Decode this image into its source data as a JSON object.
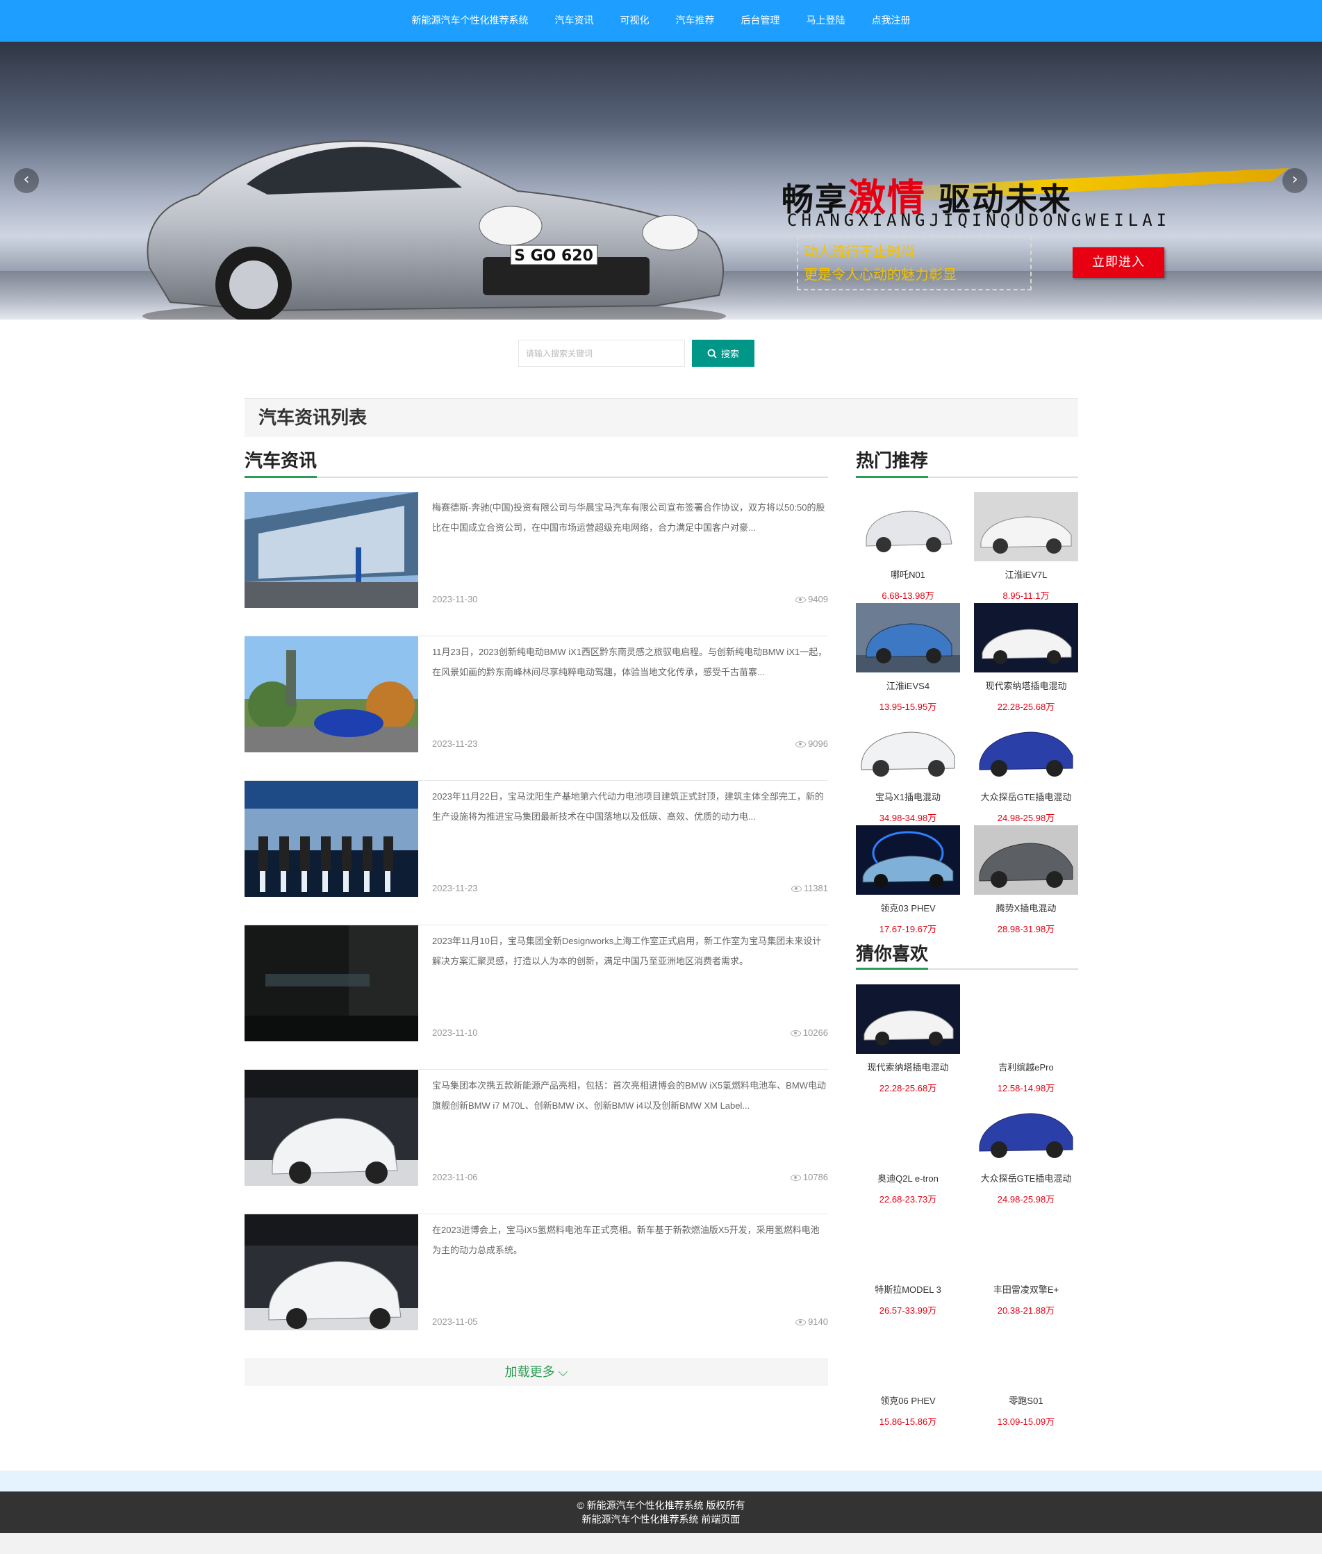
{
  "nav": {
    "items": [
      "新能源汽车个性化推荐系统",
      "汽车资讯",
      "可视化",
      "汽车推荐",
      "后台管理",
      "马上登陆",
      "点我注册"
    ]
  },
  "banner": {
    "slogan_a": "畅享",
    "slogan_hot": "激情",
    "slogan_b": " 驱动未来",
    "pinyin": "CHANGXIANGJIQINQUDONGWEILAI",
    "line1": "动人流行不止时尚",
    "line2": "更是令人心动的魅力彰显",
    "enter": "立即进入",
    "plate": "S GO 620",
    "prev": "‹",
    "next": "›",
    "active_slide": 1,
    "slide_count": 3
  },
  "search": {
    "placeholder": "请输入搜索关键词",
    "button": "搜索"
  },
  "list_header": "汽车资讯列表",
  "news_section": {
    "title": "汽车资讯",
    "items": [
      {
        "text": "梅赛德斯-奔驰(中国)投资有限公司与华晨宝马汽车有限公司宣布签署合作协议，双方将以50:50的股比在中国成立合资公司，在中国市场运营超级充电网络，合力满足中国客户对豪...",
        "date": "2023-11-30",
        "views": "9409"
      },
      {
        "text": "11月23日，2023创新纯电动BMW iX1西区黔东南灵感之旅驭电启程。与创新纯电动BMW iX1一起，在风景如画的黔东南峰林间尽享纯粹电动驾趣，体验当地文化传承，感受千古苗寨...",
        "date": "2023-11-23",
        "views": "9096"
      },
      {
        "text": "2023年11月22日，宝马沈阳生产基地第六代动力电池项目建筑正式封顶，建筑主体全部完工，新的生产设施将为推进宝马集团最新技术在中国落地以及低碳、高效、优质的动力电...",
        "date": "2023-11-23",
        "views": "11381"
      },
      {
        "text": "2023年11月10日，宝马集团全新Designworks上海工作室正式启用，新工作室为宝马集团未来设计解决方案汇聚灵感，打造以人为本的创新，满足中国乃至亚洲地区消费者需求。",
        "date": "2023-11-10",
        "views": "10266"
      },
      {
        "text": "宝马集团本次携五款新能源产品亮相，包括：首次亮相进博会的BMW iX5氢燃料电池车、BMW电动旗舰创新BMW i7 M70L、创新BMW iX、创新BMW i4以及创新BMW XM Label...",
        "date": "2023-11-06",
        "views": "10786"
      },
      {
        "text": "在2023进博会上，宝马iX5氢燃料电池车正式亮相。新车基于新款燃油版X5开发，采用氢燃料电池为主的动力总成系统。",
        "date": "2023-11-05",
        "views": "9140"
      }
    ],
    "load_more": "加载更多 ⌵"
  },
  "hot_section": {
    "title": "热门推荐",
    "items": [
      {
        "name": "哪吒N01",
        "price": "6.68-13.98万"
      },
      {
        "name": "江淮iEV7L",
        "price": "8.95-11.1万"
      },
      {
        "name": "江淮iEVS4",
        "price": "13.95-15.95万"
      },
      {
        "name": "现代索纳塔插电混动",
        "price": "22.28-25.68万"
      },
      {
        "name": "宝马X1插电混动",
        "price": "34.98-34.98万"
      },
      {
        "name": "大众探岳GTE插电混动",
        "price": "24.98-25.98万"
      },
      {
        "name": "领克03 PHEV",
        "price": "17.67-19.67万"
      },
      {
        "name": "腾势X插电混动",
        "price": "28.98-31.98万"
      }
    ]
  },
  "guess_section": {
    "title": "猜你喜欢",
    "items": [
      {
        "name": "现代索纳塔插电混动",
        "price": "22.28-25.68万"
      },
      {
        "name": "吉利缤越ePro",
        "price": "12.58-14.98万"
      },
      {
        "name": "奥迪Q2L e-tron",
        "price": "22.68-23.73万"
      },
      {
        "name": "大众探岳GTE插电混动",
        "price": "24.98-25.98万"
      },
      {
        "name": "特斯拉MODEL 3",
        "price": "26.57-33.99万"
      },
      {
        "name": "丰田雷凌双擎E+",
        "price": "20.38-21.88万"
      },
      {
        "name": "领克06 PHEV",
        "price": "15.86-15.86万"
      },
      {
        "name": "零跑S01",
        "price": "13.09-15.09万"
      }
    ]
  },
  "footer": {
    "line1": "© 新能源汽车个性化推荐系统 版权所有",
    "line2": "新能源汽车个性化推荐系统 前端页面"
  },
  "colors": {
    "nav": "#1e9fff",
    "search_button": "#009688",
    "accent_green": "#2a9d54",
    "price_red": "#e60012",
    "footer": "#333333"
  }
}
